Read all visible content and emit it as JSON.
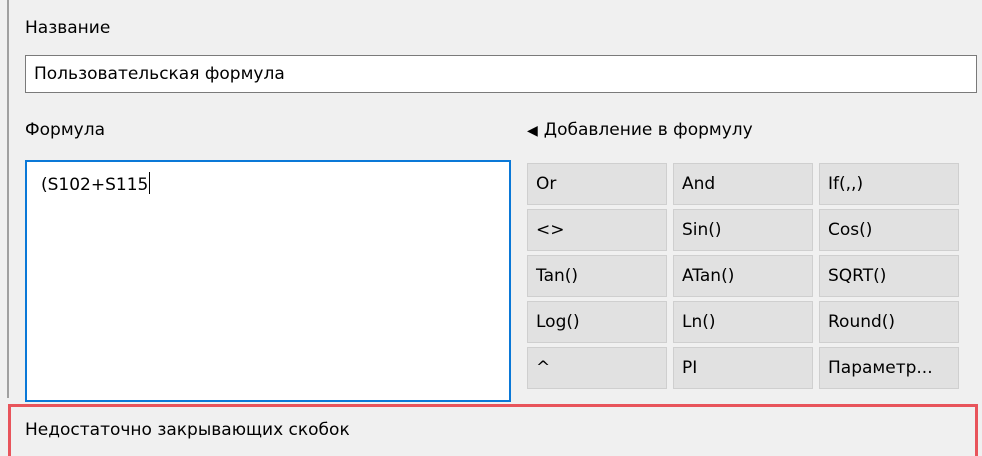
{
  "name_section": {
    "label": "Название",
    "value": "Пользовательская формула"
  },
  "formula_section": {
    "label": "Формула",
    "value": "(S102+S115"
  },
  "add_panel": {
    "header": "Добавление в формулу",
    "buttons": [
      "Or",
      "And",
      "If(,,)",
      "<>",
      "Sin()",
      "Cos()",
      "Tan()",
      "ATan()",
      "SQRT()",
      "Log()",
      "Ln()",
      "Round()",
      "^",
      "PI",
      "Параметр..."
    ]
  },
  "status": {
    "message": "Недостаточно закрывающих скобок"
  },
  "colors": {
    "focus_border": "#0a78d7",
    "error_border": "#e8545b"
  }
}
